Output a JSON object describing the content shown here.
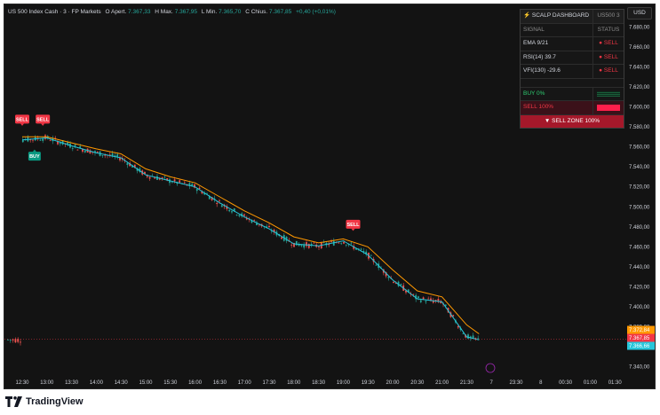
{
  "header": {
    "symbol": "US 500 Index Cash · 3 · FP Markets",
    "open_label": "O",
    "open_key": "Apert.",
    "open": "7.367,33",
    "high_label": "H",
    "high_key": "Max.",
    "high": "7.367,95",
    "low_label": "L",
    "low_key": "Min.",
    "low": "7.365,70",
    "close_label": "C",
    "close_key": "Chius.",
    "close": "7.367,85",
    "change": "+0,40 (+0,01%)"
  },
  "currency_button": "USD",
  "dashboard": {
    "title": "SCALP DASHBOARD",
    "ticker": "US500 3",
    "col_signal": "SIGNAL",
    "col_status": "STATUS",
    "rows": [
      {
        "signal": "EMA 9/21",
        "status": "● SELL"
      },
      {
        "signal": "RSI(14) 39.7",
        "status": "● SELL"
      },
      {
        "signal": "VFI(130) -29.6",
        "status": "● SELL"
      }
    ],
    "buy_label": "BUY   0%",
    "sell_label": "SELL   100%",
    "zone_label": "▼ SELL ZONE 100%",
    "buy_pct": 0,
    "sell_pct": 100
  },
  "price_tags": {
    "ema_orange": "7.372,84",
    "last_red": "7.367,85",
    "ema_teal": "7.366,66"
  },
  "markers": [
    {
      "type": "sell",
      "label": "SELL",
      "x": "12:30",
      "price": 7585
    },
    {
      "type": "sell",
      "label": "SELL",
      "x": "12:55",
      "price": 7585
    },
    {
      "type": "buy",
      "label": "BUY",
      "x": "12:45",
      "price": 7548
    },
    {
      "type": "sell",
      "label": "SELL",
      "x": "19:12",
      "price": 7480
    }
  ],
  "logo_text": "TradingView",
  "colors": {
    "up": "#26a69a",
    "down": "#ef5350",
    "ema_fast": "#26c6da",
    "ema_slow": "#ff9800",
    "sell": "#f23645",
    "buy": "#089981"
  },
  "chart_data": {
    "type": "line",
    "title": "US 500 Index Cash · 3 · FP Markets",
    "x_tick_labels": [
      "12:30",
      "13:00",
      "13:30",
      "14:00",
      "14:30",
      "15:00",
      "15:30",
      "16:00",
      "16:30",
      "17:00",
      "17:30",
      "18:00",
      "18:30",
      "19:00",
      "19:30",
      "20:00",
      "20:30",
      "21:00",
      "21:30",
      "7",
      "23:30",
      "8",
      "00:30",
      "01:00",
      "01:30"
    ],
    "y_tick_labels": [
      "7.680,00",
      "7.660,00",
      "7.640,00",
      "7.620,00",
      "7.600,00",
      "7.580,00",
      "7.560,00",
      "7.540,00",
      "7.520,00",
      "7.500,00",
      "7.480,00",
      "7.460,00",
      "7.440,00",
      "7.420,00",
      "7.400,00",
      "7.380,00",
      "7.360,00",
      "7.340,00"
    ],
    "ylim": [
      7330,
      7690
    ],
    "series": [
      {
        "x": [
          "12:30",
          "13:00",
          "13:30",
          "14:00",
          "14:30",
          "15:00",
          "15:30",
          "16:00",
          "16:30",
          "17:00",
          "17:30",
          "18:00",
          "18:30",
          "19:00",
          "19:30",
          "20:00",
          "20:30",
          "21:00",
          "21:30",
          "21:45"
        ],
        "values": [
          7567,
          7569,
          7561,
          7554,
          7549,
          7532,
          7526,
          7520,
          7504,
          7490,
          7478,
          7463,
          7461,
          7466,
          7452,
          7427,
          7408,
          7405,
          7370,
          7367
        ]
      },
      {
        "x": [
          "12:30",
          "13:00",
          "13:30",
          "14:00",
          "14:30",
          "15:00",
          "15:30",
          "16:00",
          "16:30",
          "17:00",
          "17:30",
          "18:00",
          "18:30",
          "19:00",
          "19:30",
          "20:00",
          "20:30",
          "21:00",
          "21:30",
          "21:45"
        ],
        "values": [
          7570,
          7570,
          7564,
          7558,
          7553,
          7538,
          7530,
          7524,
          7510,
          7496,
          7484,
          7470,
          7464,
          7468,
          7460,
          7437,
          7416,
          7410,
          7382,
          7373
        ]
      }
    ]
  }
}
